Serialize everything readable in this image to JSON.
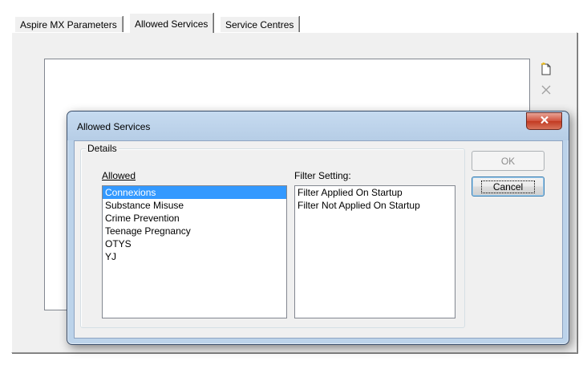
{
  "tabs": [
    {
      "label": "Aspire MX Parameters",
      "active": false
    },
    {
      "label": "Allowed Services",
      "active": true
    },
    {
      "label": "Service Centres",
      "active": false
    }
  ],
  "toolbar": {
    "new_icon": "new-document-icon",
    "delete_icon": "delete-x-icon"
  },
  "dialog": {
    "title": "Allowed Services",
    "close_icon": "close-x-icon",
    "group_label": "Details",
    "allowed_label": "Allowed",
    "allowed_items": [
      "Connexions",
      "Substance Misuse",
      "Crime Prevention",
      "Teenage Pregnancy",
      "OTYS",
      "YJ"
    ],
    "allowed_selected_index": 0,
    "filter_label": "Filter Setting:",
    "filter_items": [
      "Filter Applied On Startup",
      "Filter Not Applied On Startup"
    ],
    "ok_label": "OK",
    "cancel_label": "Cancel"
  },
  "colors": {
    "selection": "#3399ff",
    "dialog_frame": "#bcd3ea",
    "close_button": "#c8432b"
  }
}
